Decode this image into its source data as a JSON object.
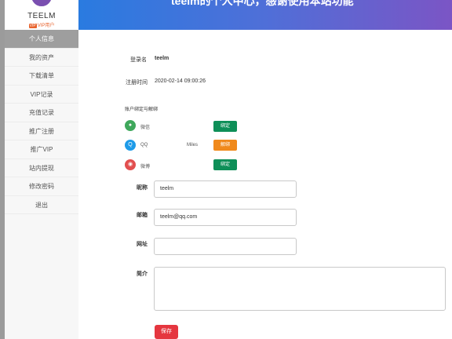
{
  "sidebar": {
    "username": "TEELM",
    "vip_badge": "VIP用户",
    "vip_mark": "VIP",
    "items": [
      {
        "label": "个人信息"
      },
      {
        "label": "我的资产"
      },
      {
        "label": "下载清单"
      },
      {
        "label": "VIP记录"
      },
      {
        "label": "充值记录"
      },
      {
        "label": "推广注册"
      },
      {
        "label": "推广VIP"
      },
      {
        "label": "站内提现"
      },
      {
        "label": "修改密码"
      },
      {
        "label": "退出"
      }
    ]
  },
  "header": {
    "banner": "teelm的个人中心，感谢使用本站功能"
  },
  "profile": {
    "login_name_label": "登录名",
    "login_name": "teelm",
    "register_time_label": "注册时间",
    "register_time": "2020-02-14 09:00:26",
    "bind_section_title": "账户绑定与解绑",
    "socials": [
      {
        "icon": "wechat-icon",
        "glyph": "●",
        "name": "微信",
        "bound_name": "",
        "action": "绑定",
        "color": "#3fa85c"
      },
      {
        "icon": "qq-icon",
        "glyph": "Q",
        "name": "QQ",
        "bound_name": "Miles",
        "action": "解绑",
        "color": "#1e9be8"
      },
      {
        "icon": "weibo-icon",
        "glyph": "◉",
        "name": "微博",
        "bound_name": "",
        "action": "绑定",
        "color": "#e24f4f"
      }
    ]
  },
  "form": {
    "nickname_label": "昵称",
    "nickname": "teelm",
    "email_label": "邮箱",
    "email": "teelm@qq.com",
    "website_label": "网址",
    "website": "",
    "bio_label": "简介",
    "bio": "",
    "save_label": "保存"
  },
  "colors": {
    "accent_red": "#e5363f",
    "bind_green": "#0e8f58",
    "unbind_orange": "#f0891c"
  }
}
